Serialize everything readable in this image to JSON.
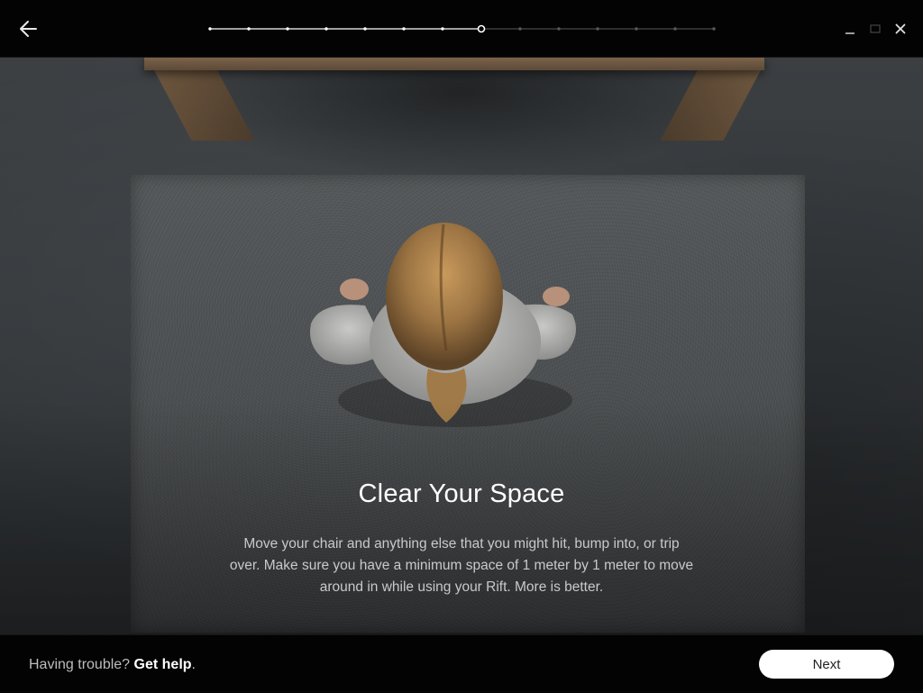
{
  "header": {
    "back_icon": "arrow-left-icon",
    "progress": {
      "total_steps": 14,
      "current_step": 8
    },
    "window_controls": [
      "minimize-icon",
      "maximize-icon",
      "close-icon"
    ]
  },
  "main": {
    "title": "Clear Your Space",
    "description": "Move your chair and anything else that you might hit, bump into, or trip over. Make sure you have a minimum space of 1 meter by 1 meter to move around in while using your Rift. More is better."
  },
  "footer": {
    "help_prefix": "Having trouble?",
    "help_link": "Get help",
    "help_suffix": ".",
    "next_label": "Next"
  },
  "colors": {
    "background": "#000000",
    "progress_complete": "#ffffff",
    "progress_incomplete": "#5a5a5a",
    "button_bg": "#ffffff"
  }
}
